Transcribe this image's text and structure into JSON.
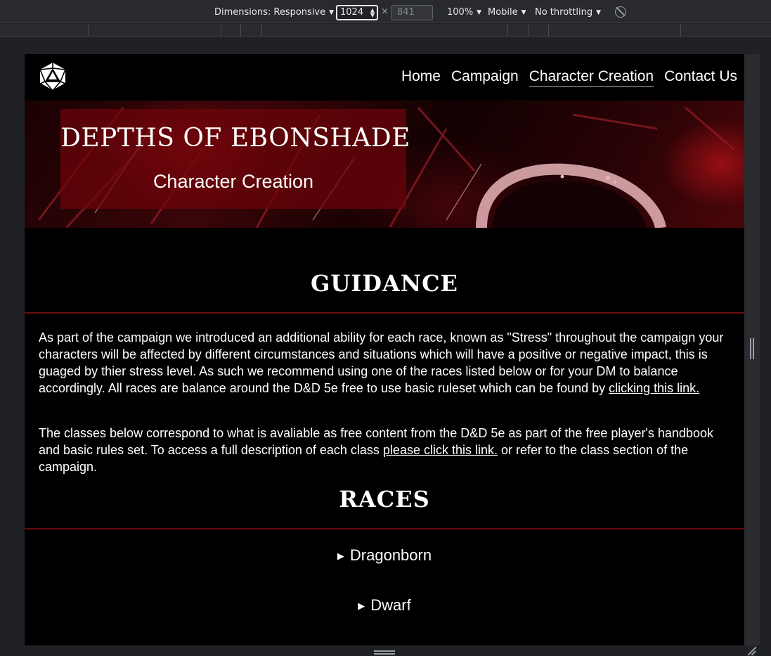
{
  "devtools": {
    "dimensions_label": "Dimensions: Responsive",
    "width_value": "1024",
    "times": "×",
    "height_value": "841",
    "zoom": "100%",
    "device": "Mobile",
    "throttling": "No throttling"
  },
  "nav": {
    "items": [
      "Home",
      "Campaign",
      "Character Creation",
      "Contact Us"
    ],
    "active": "Character Creation"
  },
  "hero": {
    "title": "DEPTHS OF EBONSHADE",
    "subtitle": "Character Creation"
  },
  "guidance": {
    "heading": "GUIDANCE",
    "para1_text": "As part of the campaign we introduced an additional ability for each race, known as \"Stress\" throughout the campaign your characters will be affected by different circumstances and situations which will have a positive or negative impact, this is guaged by thier stress level. As such we recommend using one of the races listed below or for your DM to balance accordingly. All races are balance around the D&D 5e free to use basic ruleset which can be found by ",
    "para1_link": "clicking this link.",
    "para2_text": "The classes below correspond to what is avaliable as free content from the D&D 5e as part of the free player's handbook and basic rules set. To access a full description of each class ",
    "para2_link": "please click this link.",
    "para2_tail": " or refer to the class section of the campaign."
  },
  "races": {
    "heading": "RACES",
    "items": [
      "Dragonborn",
      "Dwarf"
    ]
  },
  "colors": {
    "accent_red": "#6b0a0f",
    "background": "#000000"
  }
}
